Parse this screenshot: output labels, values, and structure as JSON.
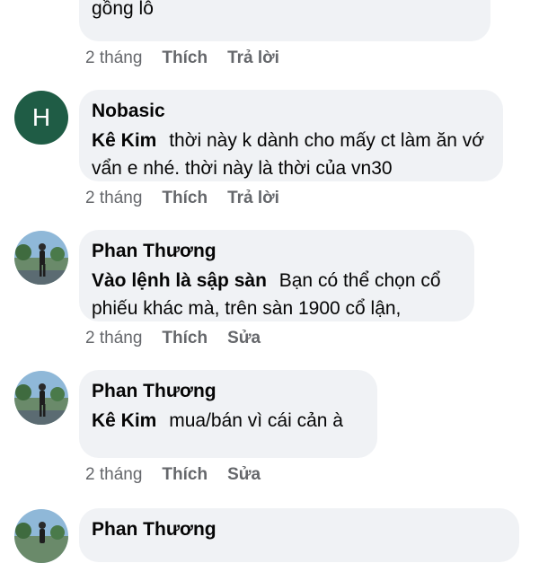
{
  "comments": [
    {
      "text": "nhanh còn kịp nếu k muốn bị chôn vốn và gồng lỗ",
      "time": "2 tháng",
      "like": "Thích",
      "action": "Trả lời"
    },
    {
      "author": "Nobasic",
      "avatar_letter": "H",
      "mention": "Kê Kim",
      "text": "thời này k dành cho mấy ct làm ăn vớ vẩn e nhé. thời này là thời của vn30",
      "time": "2 tháng",
      "like": "Thích",
      "action": "Trả lời"
    },
    {
      "author": "Phan Thương",
      "mention": "Vào lệnh là sập sàn",
      "text": "Bạn có thể chọn cổ phiếu khác mà, trên sàn 1900 cổ lận,",
      "time": "2 tháng",
      "like": "Thích",
      "action": "Sửa"
    },
    {
      "author": "Phan Thương",
      "mention": "Kê Kim",
      "text": "mua/bán vì cái cản à",
      "time": "2 tháng",
      "like": "Thích",
      "action": "Sửa"
    },
    {
      "author": "Phan Thương"
    }
  ],
  "colors": {
    "bubble": "#f0f2f5",
    "meta_text": "#65676b",
    "avatar_letter_bg": "#1f5c45"
  }
}
